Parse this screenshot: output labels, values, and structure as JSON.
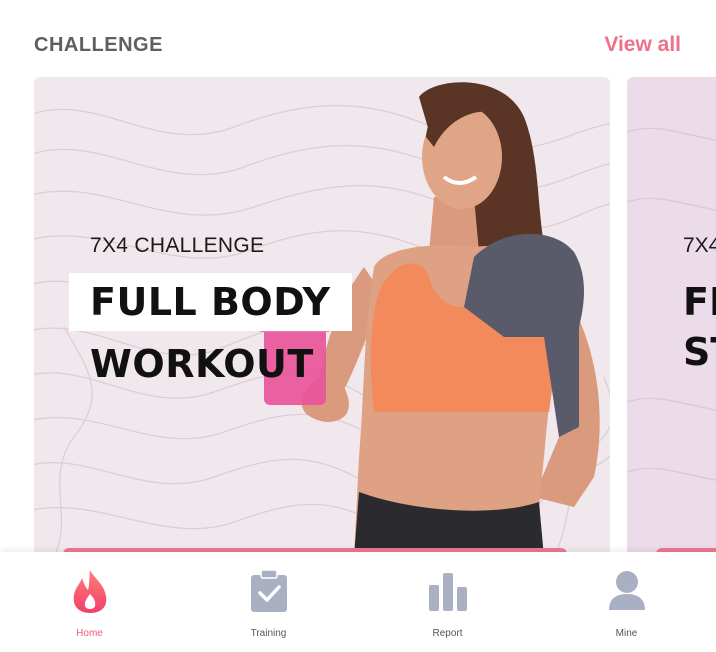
{
  "section": {
    "title": "CHALLENGE",
    "view_all": "View all"
  },
  "cards": [
    {
      "subtitle": "7X4 CHALLENGE",
      "title_line1": "FULL BODY",
      "title_line2": "WORKOUT"
    },
    {
      "subtitle": "7X4",
      "title_line1": "FI",
      "title_line2": "ST"
    }
  ],
  "nav": {
    "items": [
      {
        "label": "Home",
        "icon": "flame-icon",
        "active": true
      },
      {
        "label": "Training",
        "icon": "clipboard-check-icon",
        "active": false
      },
      {
        "label": "Report",
        "icon": "bar-chart-icon",
        "active": false
      },
      {
        "label": "Mine",
        "icon": "person-icon",
        "active": false
      }
    ]
  },
  "colors": {
    "accent": "#ef7088",
    "nav_inactive": "#a9b0c3"
  }
}
